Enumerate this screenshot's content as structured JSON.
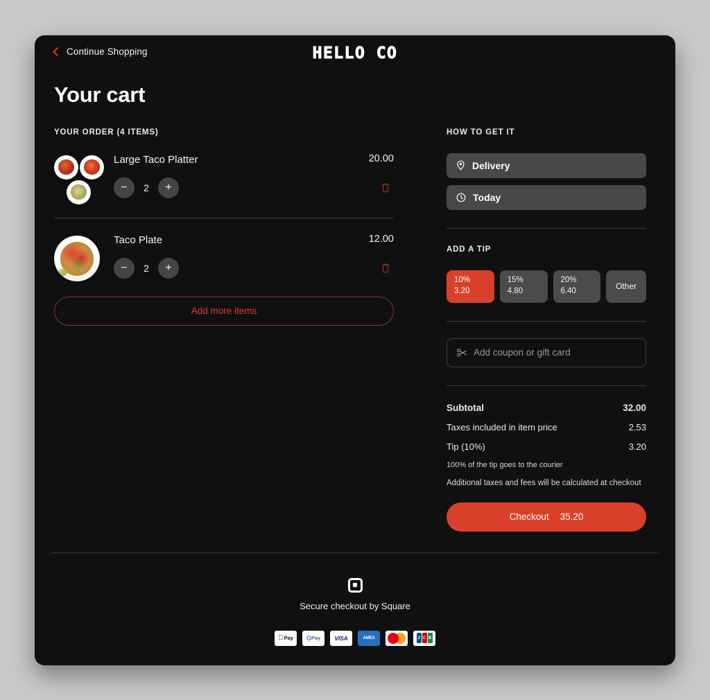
{
  "header": {
    "back_label": "Continue Shopping",
    "back_icon": "chevron-left-icon",
    "brand": "HELLO CO"
  },
  "page_title": "Your cart",
  "order": {
    "section_label": "YOUR ORDER (4 ITEMS)",
    "items": [
      {
        "name": "Large Taco Platter",
        "price": "20.00",
        "qty": "2",
        "decrement_label": "−",
        "increment_label": "+",
        "remove_icon": "trash-icon",
        "thumb_type": "cluster"
      },
      {
        "name": "Taco Plate",
        "price": "12.00",
        "qty": "2",
        "decrement_label": "−",
        "increment_label": "+",
        "remove_icon": "trash-icon",
        "thumb_type": "single"
      }
    ],
    "add_more_label": "Add more items"
  },
  "fulfillment": {
    "section_label": "HOW TO GET IT",
    "method": {
      "label": "Delivery",
      "icon": "location-pin-icon"
    },
    "time": {
      "label": "Today",
      "icon": "clock-icon"
    }
  },
  "tip": {
    "section_label": "ADD A TIP",
    "options": [
      {
        "percent": "10%",
        "amount": "3.20",
        "selected": true
      },
      {
        "percent": "15%",
        "amount": "4.80",
        "selected": false
      },
      {
        "percent": "20%",
        "amount": "6.40",
        "selected": false
      }
    ],
    "other_label": "Other"
  },
  "coupon": {
    "placeholder": "Add coupon or gift card",
    "icon": "scissors-coupon-icon",
    "value": ""
  },
  "summary": {
    "lines": [
      {
        "label": "Subtotal",
        "value": "32.00",
        "bold": true
      },
      {
        "label": "Taxes included in item price",
        "value": "2.53",
        "bold": false
      },
      {
        "label": "Tip (10%)",
        "value": "3.20",
        "bold": false
      }
    ],
    "tip_note": "100% of the tip goes to the courier",
    "fees_note": "Additional taxes and fees will be calculated at checkout"
  },
  "checkout": {
    "label": "Checkout",
    "total": "35.20"
  },
  "footer": {
    "logo_icon": "square-logo-icon",
    "secure_text": "Secure checkout by Square",
    "payment_methods": [
      {
        "name": "apple-pay",
        "label": "Pay"
      },
      {
        "name": "google-pay",
        "label": "Pay"
      },
      {
        "name": "visa",
        "label": "VISA"
      },
      {
        "name": "amex",
        "label": "AMEX"
      },
      {
        "name": "mastercard",
        "label": ""
      },
      {
        "name": "jcb",
        "label": "JCB"
      }
    ]
  },
  "colors": {
    "accent": "#d9402a",
    "card_bg": "#101010",
    "page_bg": "#c9c9c9",
    "control_bg": "#484848"
  }
}
